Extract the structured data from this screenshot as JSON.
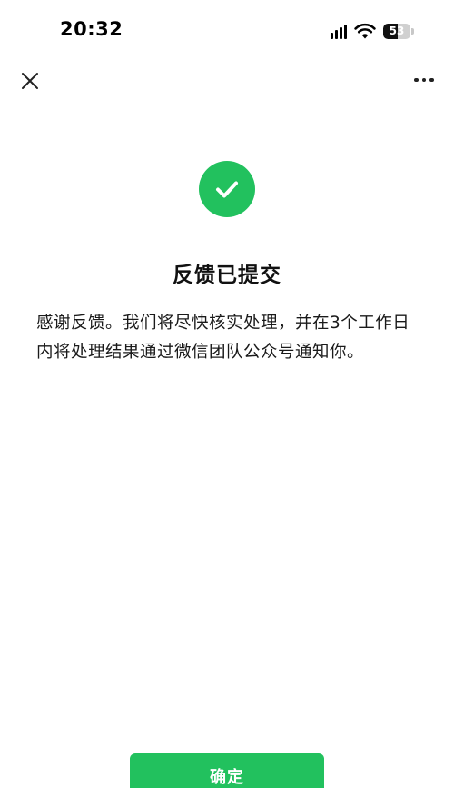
{
  "status_bar": {
    "time": "20:32",
    "battery_level": "53",
    "icons": [
      "signal-icon",
      "wifi-icon",
      "battery-icon"
    ]
  },
  "nav": {
    "close_icon": "close-icon",
    "more_icon": "more-icon"
  },
  "result": {
    "icon": "checkmark-icon",
    "title": "反馈已提交",
    "message": "感谢反馈。我们将尽快核实处理，并在3个工作日内将处理结果通过微信团队公众号通知你。"
  },
  "actions": {
    "confirm_label": "确定"
  },
  "colors": {
    "accent": "#22c15e",
    "background": "#ffffff",
    "text": "#111111"
  }
}
